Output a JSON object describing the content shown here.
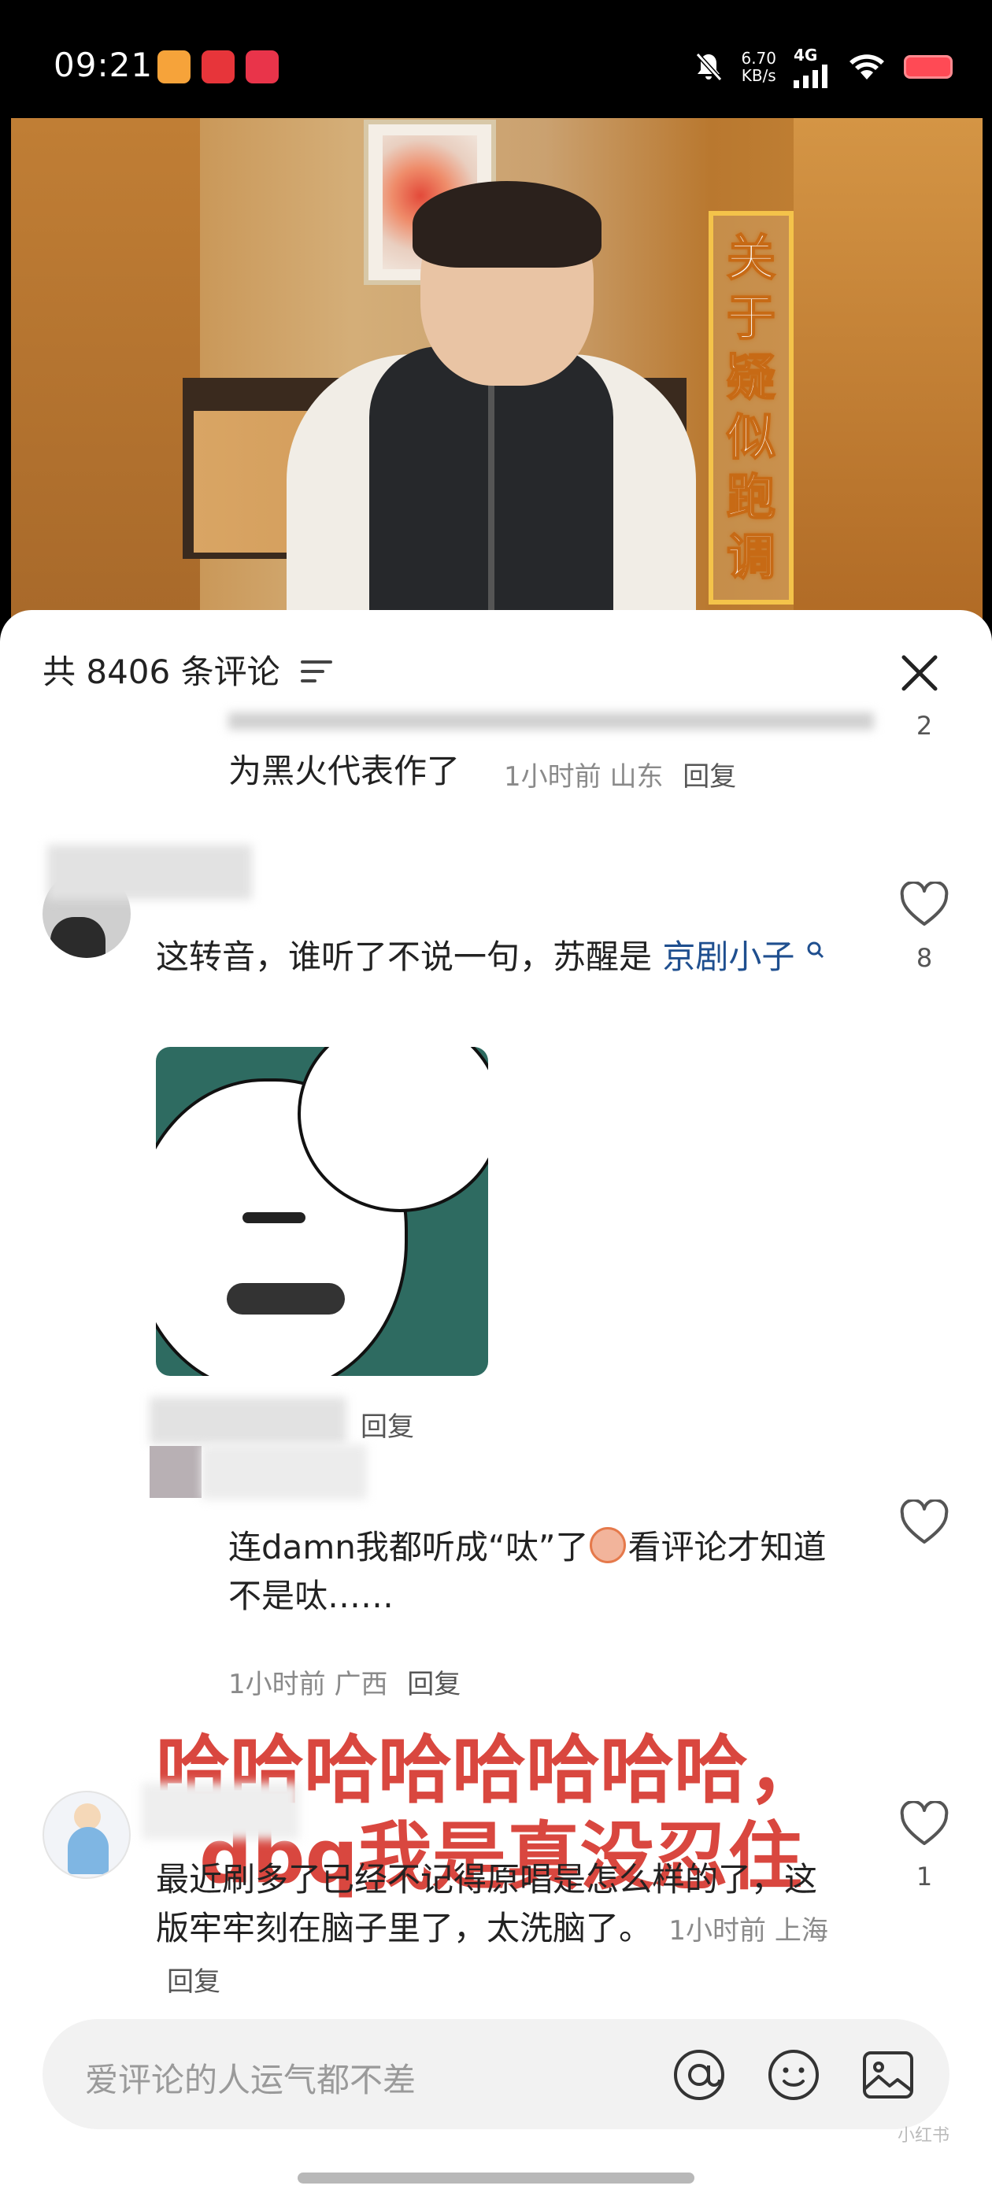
{
  "status_bar": {
    "time": "09:21",
    "speed_value": "6.70",
    "speed_unit": "KB/s",
    "network": "4G",
    "icons": [
      "app-icon-1",
      "app-icon-2",
      "app-icon-3",
      "bell-muted-icon",
      "signal-icon",
      "wifi-icon",
      "battery-icon"
    ]
  },
  "video": {
    "caption_chars": [
      "关",
      "于",
      "疑",
      "似",
      "跑",
      "调"
    ]
  },
  "comments_header": {
    "title": "共 8406 条评论",
    "sort_icon": "sort-icon",
    "close_icon": "close-icon"
  },
  "comments": [
    {
      "text": "为黑火代表作了",
      "time": "1小时前",
      "location": "山东",
      "reply": "回复",
      "like_count": "2"
    },
    {
      "text_before_link": "这转音，谁听了不说一句，苏醒是",
      "link_text": "京剧小子",
      "link_icon": "search-icon",
      "has_image": true,
      "meta_fragment": "回复",
      "like_count": "8"
    },
    {
      "text_part1": "连damn我都听成“呔”了",
      "emoji": "laughing-emoji-icon",
      "text_part2": "看评论才知道不是呔……",
      "time": "1小时前",
      "location": "广西",
      "reply": "回复",
      "like_count": ""
    },
    {
      "text": "最近刷多了已经不记得原唱是怎么样的了，这版牢牢刻在脑子里了，太洗脑了。",
      "time": "1小时前",
      "location": "上海",
      "reply": "回复",
      "like_count": "1"
    }
  ],
  "overlay": {
    "line1": "哈哈哈哈哈哈哈哈，",
    "line2": "dbq我是真没忍住"
  },
  "input_bar": {
    "placeholder": "爱评论的人运气都不差",
    "icons": [
      "at-icon",
      "emoji-icon",
      "image-icon"
    ]
  },
  "watermark": "小红书",
  "colors": {
    "overlay_red": "#d9473f",
    "link_blue": "#1f4f8f",
    "battery_red": "#ff4a55"
  }
}
